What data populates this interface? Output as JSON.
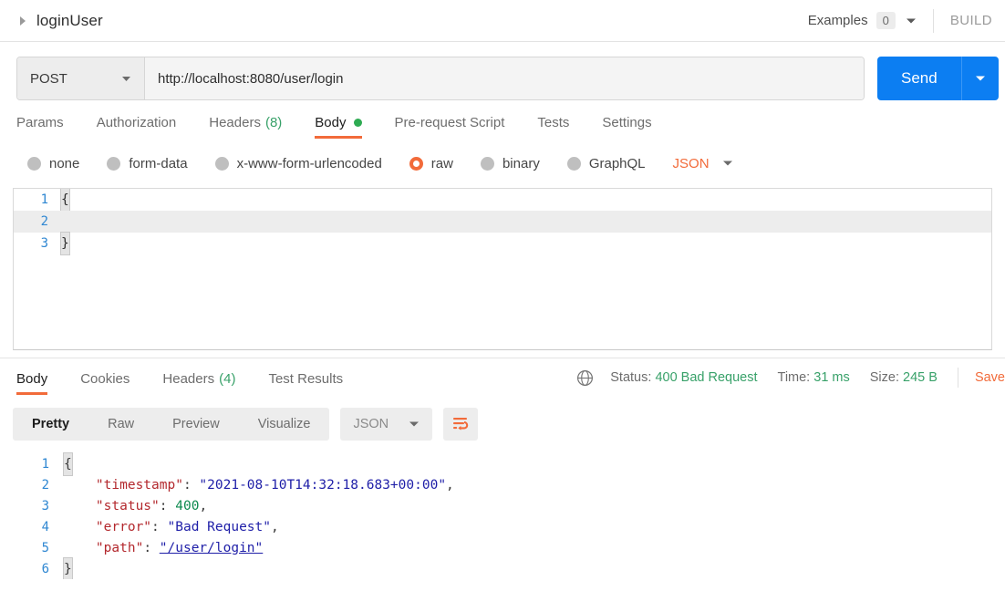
{
  "topbar": {
    "request_name": "loginUser",
    "collapse_icon": "triangle-right-icon",
    "examples_label": "Examples",
    "examples_count": "0",
    "examples_caret_icon": "chevron-down-icon",
    "build_label": "BUILD"
  },
  "url_row": {
    "method": "POST",
    "method_caret_icon": "chevron-down-icon",
    "url": "http://localhost:8080/user/login",
    "url_placeholder": "Enter request URL",
    "send_label": "Send",
    "send_caret_icon": "chevron-down-icon",
    "send_color": "#0c7ef2"
  },
  "request_tabs": [
    {
      "label": "Params",
      "active": false
    },
    {
      "label": "Authorization",
      "active": false
    },
    {
      "label": "Headers",
      "count": "(8)",
      "active": false
    },
    {
      "label": "Body",
      "active": true,
      "dot": true
    },
    {
      "label": "Pre-request Script",
      "active": false
    },
    {
      "label": "Tests",
      "active": false
    },
    {
      "label": "Settings",
      "active": false
    }
  ],
  "body_types": [
    {
      "label": "none",
      "selected": false
    },
    {
      "label": "form-data",
      "selected": false
    },
    {
      "label": "x-www-form-urlencoded",
      "selected": false
    },
    {
      "label": "raw",
      "selected": true
    },
    {
      "label": "binary",
      "selected": false
    },
    {
      "label": "GraphQL",
      "selected": false
    }
  ],
  "body_format": {
    "label": "JSON",
    "caret_icon": "chevron-down-icon",
    "color": "#f26b3a"
  },
  "request_editor": {
    "lines": [
      {
        "num": "1",
        "text": "{",
        "active": false
      },
      {
        "num": "2",
        "text": "",
        "active": true
      },
      {
        "num": "3",
        "text": "}",
        "active": false
      }
    ]
  },
  "response": {
    "tabs": [
      {
        "label": "Body",
        "active": true
      },
      {
        "label": "Cookies",
        "active": false
      },
      {
        "label": "Headers",
        "count": "(4)",
        "active": false
      },
      {
        "label": "Test Results",
        "active": false
      }
    ],
    "status_bar": {
      "globe_icon": "globe-icon",
      "status_label": "Status:",
      "status_value": "400 Bad Request",
      "time_label": "Time:",
      "time_value": "31 ms",
      "size_label": "Size:",
      "size_value": "245 B",
      "save_label": "Save",
      "value_color": "#38a169"
    },
    "toolbar": {
      "segments": [
        {
          "label": "Pretty",
          "active": true
        },
        {
          "label": "Raw",
          "active": false
        },
        {
          "label": "Preview",
          "active": false
        },
        {
          "label": "Visualize",
          "active": false
        }
      ],
      "format_label": "JSON",
      "format_caret_icon": "chevron-down-icon",
      "wrap_icon": "word-wrap-icon",
      "wrap_color": "#f26b3a"
    },
    "body_lines": [
      {
        "num": "1",
        "open": "{"
      },
      {
        "num": "2",
        "key": "\"timestamp\"",
        "colon": ": ",
        "value": "\"2021-08-10T14:32:18.683+00:00\"",
        "comma": ",",
        "type": "string"
      },
      {
        "num": "3",
        "key": "\"status\"",
        "colon": ": ",
        "value": "400",
        "comma": ",",
        "type": "number"
      },
      {
        "num": "4",
        "key": "\"error\"",
        "colon": ": ",
        "value": "\"Bad Request\"",
        "comma": ",",
        "type": "string"
      },
      {
        "num": "5",
        "key": "\"path\"",
        "colon": ": ",
        "value": "\"/user/login\"",
        "comma": "",
        "type": "link"
      },
      {
        "num": "6",
        "close": "}"
      }
    ]
  }
}
